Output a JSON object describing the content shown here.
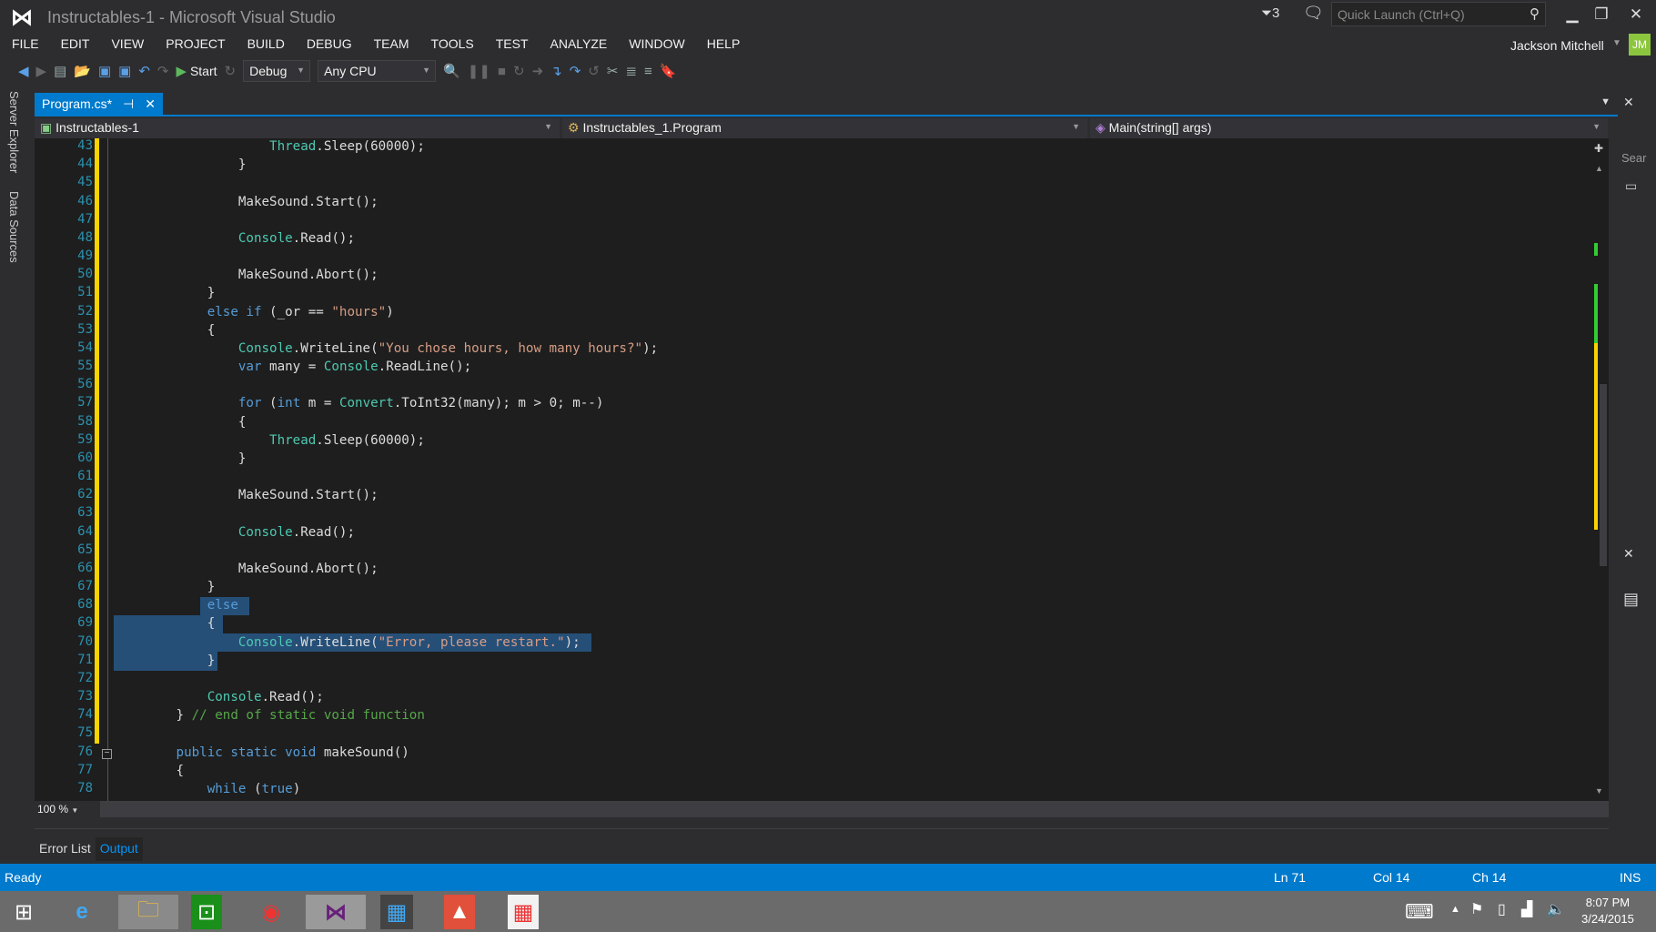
{
  "window": {
    "title": "Instructables-1 - Microsoft Visual Studio",
    "notifications": "3",
    "quick_launch_placeholder": "Quick Launch (Ctrl+Q)",
    "user": "Jackson Mitchell",
    "avatar_initials": "JM"
  },
  "menu": [
    "FILE",
    "EDIT",
    "VIEW",
    "PROJECT",
    "BUILD",
    "DEBUG",
    "TEAM",
    "TOOLS",
    "TEST",
    "ANALYZE",
    "WINDOW",
    "HELP"
  ],
  "toolbar": {
    "start_label": "Start",
    "configuration": "Debug",
    "platform": "Any CPU"
  },
  "side_tabs": [
    "Server Explorer",
    "Data Sources"
  ],
  "tab": {
    "label": "Program.cs*"
  },
  "nav": {
    "project": "Instructables-1",
    "class": "Instructables_1.Program",
    "member": "Main(string[] args)"
  },
  "right_pane": {
    "search": "Sear"
  },
  "code": [
    {
      "n": "43",
      "t": [
        [
          "ty",
          "            Thread"
        ],
        [
          "pl",
          ".Sleep(60000);"
        ]
      ]
    },
    {
      "n": "44",
      "t": [
        [
          "pl",
          "        }"
        ]
      ]
    },
    {
      "n": "45",
      "t": []
    },
    {
      "n": "46",
      "t": [
        [
          "pl",
          "        MakeSound.Start();"
        ]
      ]
    },
    {
      "n": "47",
      "t": []
    },
    {
      "n": "48",
      "t": [
        [
          "ty",
          "        Console"
        ],
        [
          "pl",
          ".Read();"
        ]
      ]
    },
    {
      "n": "49",
      "t": []
    },
    {
      "n": "50",
      "t": [
        [
          "pl",
          "        MakeSound.Abort();"
        ]
      ]
    },
    {
      "n": "51",
      "t": [
        [
          "pl",
          "    }"
        ]
      ]
    },
    {
      "n": "52",
      "t": [
        [
          "kw",
          "    else if"
        ],
        [
          "pl",
          " (_or == "
        ],
        [
          "st",
          "\"hours\""
        ],
        [
          "pl",
          ")"
        ]
      ]
    },
    {
      "n": "53",
      "t": [
        [
          "pl",
          "    {"
        ]
      ]
    },
    {
      "n": "54",
      "t": [
        [
          "ty",
          "        Console"
        ],
        [
          "pl",
          ".WriteLine("
        ],
        [
          "st",
          "\"You chose hours, how many hours?\""
        ],
        [
          "pl",
          ");"
        ]
      ]
    },
    {
      "n": "55",
      "t": [
        [
          "kw",
          "        var"
        ],
        [
          "pl",
          " many = "
        ],
        [
          "ty",
          "Console"
        ],
        [
          "pl",
          ".ReadLine();"
        ]
      ]
    },
    {
      "n": "56",
      "t": []
    },
    {
      "n": "57",
      "t": [
        [
          "kw",
          "        for"
        ],
        [
          "pl",
          " ("
        ],
        [
          "kw",
          "int"
        ],
        [
          "pl",
          " m = "
        ],
        [
          "ty",
          "Convert"
        ],
        [
          "pl",
          ".ToInt32(many); m > 0; m--)"
        ]
      ]
    },
    {
      "n": "58",
      "t": [
        [
          "pl",
          "        {"
        ]
      ]
    },
    {
      "n": "59",
      "t": [
        [
          "ty",
          "            Thread"
        ],
        [
          "pl",
          ".Sleep(60000);"
        ]
      ]
    },
    {
      "n": "60",
      "t": [
        [
          "pl",
          "        }"
        ]
      ]
    },
    {
      "n": "61",
      "t": []
    },
    {
      "n": "62",
      "t": [
        [
          "pl",
          "        MakeSound.Start();"
        ]
      ]
    },
    {
      "n": "63",
      "t": []
    },
    {
      "n": "64",
      "t": [
        [
          "ty",
          "        Console"
        ],
        [
          "pl",
          ".Read();"
        ]
      ]
    },
    {
      "n": "65",
      "t": []
    },
    {
      "n": "66",
      "t": [
        [
          "pl",
          "        MakeSound.Abort();"
        ]
      ]
    },
    {
      "n": "67",
      "t": [
        [
          "pl",
          "    }"
        ]
      ]
    },
    {
      "n": "68",
      "t": [
        [
          "kw",
          "    else"
        ]
      ]
    },
    {
      "n": "69",
      "t": [
        [
          "pl",
          "    {"
        ]
      ]
    },
    {
      "n": "70",
      "t": [
        [
          "ty",
          "        Console"
        ],
        [
          "pl",
          ".WriteLine("
        ],
        [
          "st",
          "\"Error, please restart.\""
        ],
        [
          "pl",
          ");"
        ]
      ]
    },
    {
      "n": "71",
      "t": [
        [
          "pl",
          "    }"
        ]
      ]
    },
    {
      "n": "72",
      "t": []
    },
    {
      "n": "73",
      "t": [
        [
          "ty",
          "    Console"
        ],
        [
          "pl",
          ".Read();"
        ]
      ]
    },
    {
      "n": "74",
      "t": [
        [
          "pl",
          "} "
        ],
        [
          "cm",
          "// end of static void function"
        ]
      ]
    },
    {
      "n": "75",
      "t": []
    },
    {
      "n": "76",
      "t": [
        [
          "kw",
          "public static void"
        ],
        [
          "pl",
          " makeSound()"
        ]
      ]
    },
    {
      "n": "77",
      "t": [
        [
          "pl",
          "{"
        ]
      ]
    },
    {
      "n": "78",
      "t": [
        [
          "kw",
          "    while"
        ],
        [
          "pl",
          " ("
        ],
        [
          "kw",
          "true"
        ],
        [
          "pl",
          ")"
        ]
      ]
    }
  ],
  "zoom": "100 %",
  "bottom_tabs": [
    "Error List",
    "Output"
  ],
  "status": {
    "state": "Ready",
    "ln": "Ln 71",
    "col": "Col 14",
    "ch": "Ch 14",
    "mode": "INS"
  },
  "clock": {
    "time": "8:07 PM",
    "date": "3/24/2015"
  }
}
